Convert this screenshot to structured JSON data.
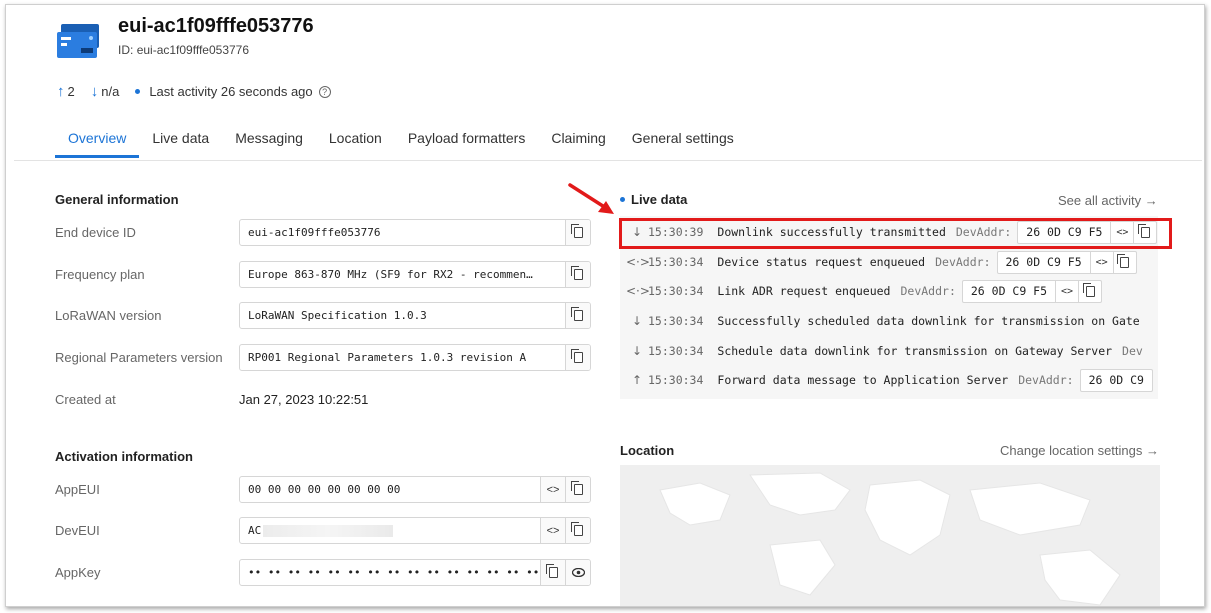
{
  "device": {
    "title": "eui-ac1f09fffe053776",
    "id_label": "ID:",
    "id_value": "eui-ac1f09fffe053776"
  },
  "stats": {
    "uplink_count": "2",
    "downlink_count": "n/a",
    "last_activity": "Last activity 26 seconds ago"
  },
  "tabs": [
    "Overview",
    "Live data",
    "Messaging",
    "Location",
    "Payload formatters",
    "Claiming",
    "General settings"
  ],
  "general": {
    "title": "General information",
    "end_device_id_label": "End device ID",
    "end_device_id": "eui-ac1f09fffe053776",
    "frequency_plan_label": "Frequency plan",
    "frequency_plan": "Europe 863-870 MHz (SF9 for RX2 - recommen…",
    "lorawan_label": "LoRaWAN version",
    "lorawan": "LoRaWAN Specification 1.0.3",
    "regional_label": "Regional Parameters version",
    "regional": "RP001 Regional Parameters 1.0.3 revision A",
    "created_label": "Created at",
    "created": "Jan 27, 2023 10:22:51"
  },
  "activation": {
    "title": "Activation information",
    "appeui_label": "AppEUI",
    "appeui": "00 00 00 00 00 00 00 00",
    "deveui_label": "DevEUI",
    "deveui": "AC",
    "appkey_label": "AppKey",
    "appkey": "•• •• •• •• •• •• •• •• •• •• •• •• •• •• •• ••"
  },
  "live": {
    "title": "Live data",
    "see_all": "See all activity →",
    "devaddr_label": "DevAddr:",
    "rows": [
      {
        "dir": "↓",
        "time": "15:30:39",
        "msg": "Downlink successfully transmitted",
        "addr": "26 0D C9 F5"
      },
      {
        "dir": "<·>",
        "time": "15:30:34",
        "msg": "Device status request enqueued",
        "addr": "26 0D C9 F5"
      },
      {
        "dir": "<·>",
        "time": "15:30:34",
        "msg": "Link ADR request enqueued",
        "addr": "26 0D C9 F5"
      },
      {
        "dir": "↓",
        "time": "15:30:34",
        "msg": "Successfully scheduled data downlink for transmission on Gate",
        "addr": ""
      },
      {
        "dir": "↓",
        "time": "15:30:34",
        "msg": "Schedule data downlink for transmission on Gateway Server",
        "addr": "Dev"
      },
      {
        "dir": "↑",
        "time": "15:30:34",
        "msg": "Forward data message to Application Server",
        "addr": "26 0D C9"
      }
    ]
  },
  "location": {
    "title": "Location",
    "change_link": "Change location settings →"
  },
  "colors": {
    "accent": "#1c74d6",
    "highlight": "#e21a1a",
    "icon_blue": "#1a5fb4"
  }
}
